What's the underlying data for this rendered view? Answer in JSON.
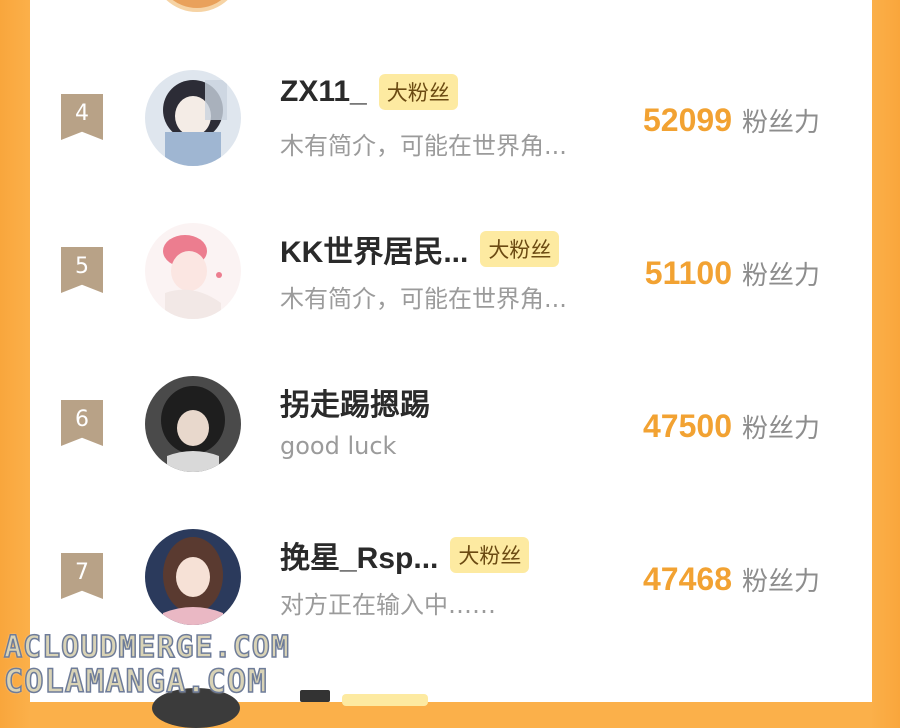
{
  "colors": {
    "side_orange": "#fbb04a",
    "rank_badge": "#b8a287",
    "score": "#f2a232",
    "fan_badge_bg": "#fdeaa1"
  },
  "rows": [
    {
      "rank": "4",
      "name": "ZX11_",
      "badge": "大粉丝",
      "bio": "木有简介，可能在世界角...",
      "score": "52099",
      "unit": "粉丝力"
    },
    {
      "rank": "5",
      "name": "KK世界居民...",
      "badge": "大粉丝",
      "bio": "木有简介，可能在世界角...",
      "score": "51100",
      "unit": "粉丝力"
    },
    {
      "rank": "6",
      "name": "拐走踢摁踢",
      "badge": "",
      "bio": "good luck",
      "score": "47500",
      "unit": "粉丝力"
    },
    {
      "rank": "7",
      "name": "挽星_Rsp...",
      "badge": "大粉丝",
      "bio": "对方正在输入中……",
      "score": "47468",
      "unit": "粉丝力"
    }
  ],
  "watermark": {
    "line1": "ACLOUDMERGE.COM",
    "line2": "COLAMANGA.COM"
  }
}
